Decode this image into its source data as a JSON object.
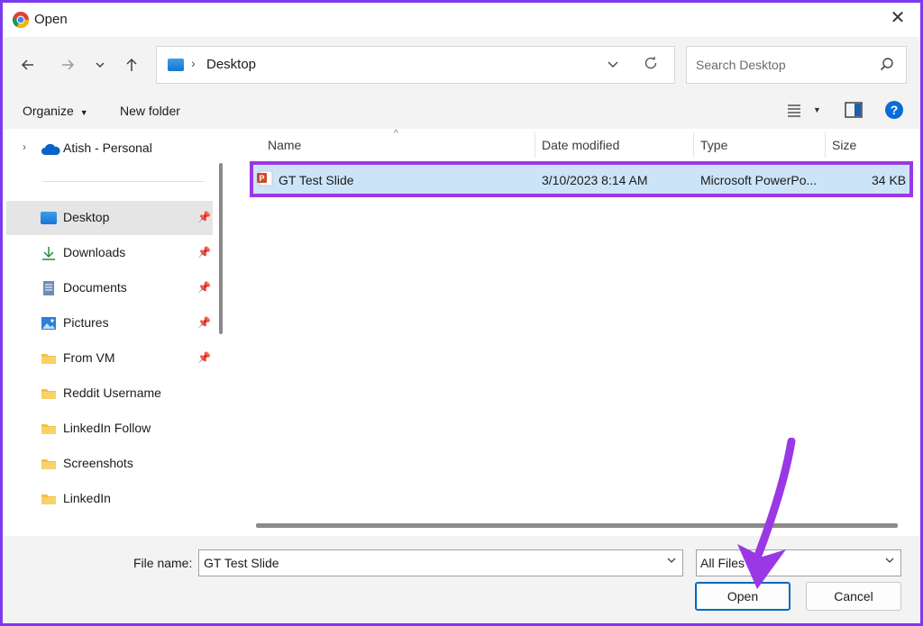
{
  "window": {
    "title": "Open"
  },
  "nav": {
    "address": "Desktop",
    "search_placeholder": "Search Desktop"
  },
  "toolbar": {
    "organize": "Organize",
    "new_folder": "New folder"
  },
  "sidebar": {
    "onedrive": "Atish - Personal",
    "items": [
      {
        "label": "Desktop",
        "icon": "desktop-icon",
        "pinned": true,
        "active": true
      },
      {
        "label": "Downloads",
        "icon": "download-icon",
        "pinned": true
      },
      {
        "label": "Documents",
        "icon": "document-icon",
        "pinned": true
      },
      {
        "label": "Pictures",
        "icon": "pictures-icon",
        "pinned": true
      },
      {
        "label": "From VM",
        "icon": "folder-icon",
        "pinned": true
      },
      {
        "label": "Reddit Username",
        "icon": "folder-icon",
        "pinned": false
      },
      {
        "label": "LinkedIn Follow",
        "icon": "folder-icon",
        "pinned": false
      },
      {
        "label": "Screenshots",
        "icon": "folder-icon",
        "pinned": false
      },
      {
        "label": "LinkedIn",
        "icon": "folder-icon",
        "pinned": false
      }
    ]
  },
  "columns": {
    "name": "Name",
    "date": "Date modified",
    "type": "Type",
    "size": "Size"
  },
  "files": [
    {
      "name": "GT Test Slide",
      "date": "3/10/2023 8:14 AM",
      "type": "Microsoft PowerPo...",
      "size": "34 KB"
    }
  ],
  "bottom": {
    "file_name_label": "File name:",
    "file_name_value": "GT Test Slide",
    "filter": "All Files",
    "open": "Open",
    "cancel": "Cancel"
  },
  "colors": {
    "highlight_border": "#9b38e6",
    "selected_row": "#cce4f7",
    "arrow": "#9b38e6"
  }
}
